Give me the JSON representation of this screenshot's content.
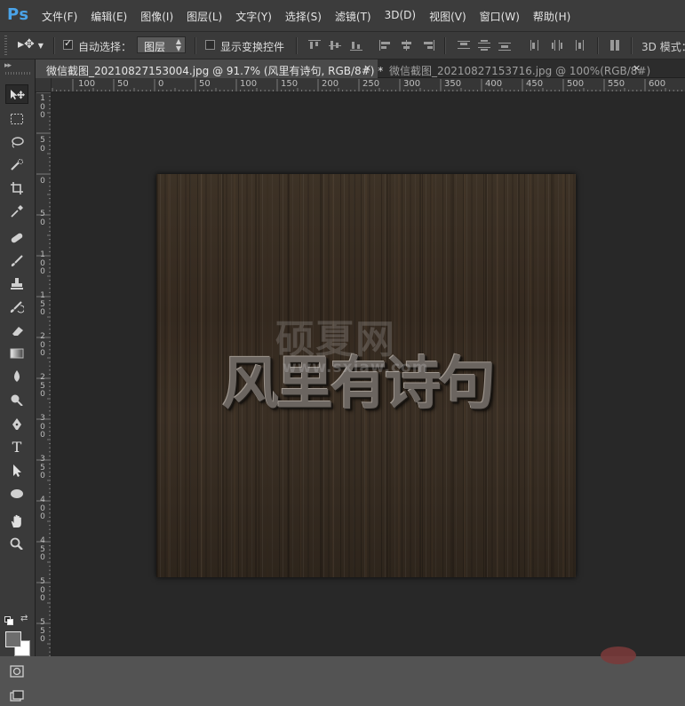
{
  "app": {
    "logo": "Ps"
  },
  "menu": {
    "items": [
      "文件(F)",
      "编辑(E)",
      "图像(I)",
      "图层(L)",
      "文字(Y)",
      "选择(S)",
      "滤镜(T)",
      "3D(D)",
      "视图(V)",
      "窗口(W)",
      "帮助(H)"
    ]
  },
  "options": {
    "auto_select_label": "自动选择：",
    "auto_select_checked": true,
    "layer_select_value": "图层",
    "show_transform_label": "显示变换控件",
    "show_transform_checked": false,
    "mode_3d_label": "3D 模式："
  },
  "tabs": [
    {
      "title": "微信截图_20210827153004.jpg @ 91.7% (风里有诗句, RGB/8#) *",
      "close": "×",
      "active": true
    },
    {
      "title": "微信截图_20210827153716.jpg @ 100%(RGB/8#)",
      "close": "×",
      "active": false
    }
  ],
  "ruler": {
    "h_labels": [
      "100",
      "50",
      "0",
      "50",
      "100",
      "150",
      "200",
      "250",
      "300",
      "350",
      "400",
      "450",
      "500",
      "550",
      "600"
    ],
    "v_labels": [
      "100",
      "50",
      "0",
      "50",
      "100",
      "150",
      "200",
      "250",
      "300",
      "350",
      "400",
      "450",
      "500",
      "550"
    ]
  },
  "canvas": {
    "text_layer": "风里有诗句",
    "watermark_cn": "硕夏网",
    "watermark_url": "www.sxiaw.com"
  },
  "colors": {
    "accent": "#4aa3e8",
    "foreground": "#6d6d6d",
    "background": "#ffffff"
  },
  "tools": [
    "move-tool",
    "marquee-tool",
    "lasso-tool",
    "quick-selection-tool",
    "crop-tool",
    "eyedropper-tool",
    "healing-brush-tool",
    "brush-tool",
    "clone-stamp-tool",
    "history-brush-tool",
    "eraser-tool",
    "gradient-tool",
    "blur-tool",
    "dodge-tool",
    "pen-tool",
    "type-tool",
    "path-selection-tool",
    "ellipse-tool",
    "hand-tool",
    "zoom-tool",
    "quick-mask-tool",
    "screen-mode-tool"
  ]
}
